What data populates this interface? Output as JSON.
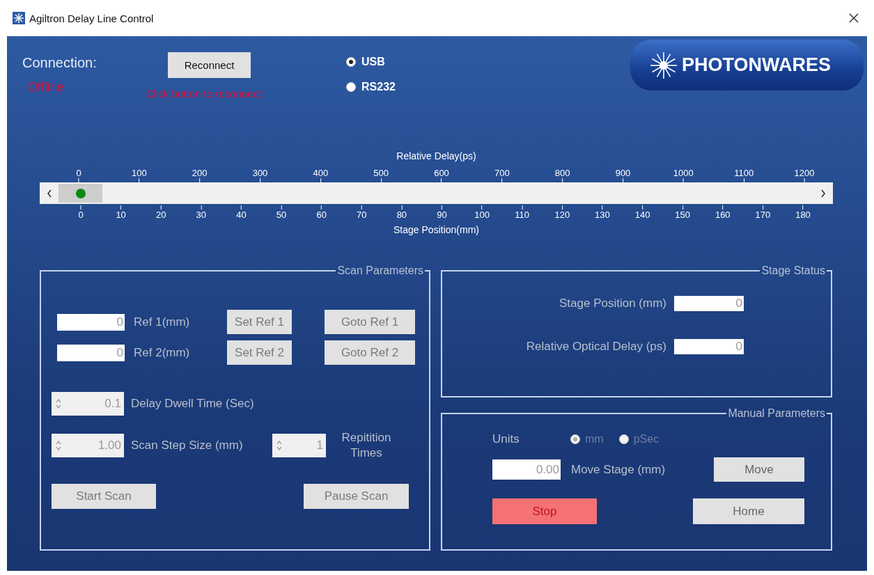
{
  "window": {
    "title": "Agiltron Delay Line Control"
  },
  "connection": {
    "label": "Connection:",
    "button": "Reconnect",
    "status": "Offline",
    "hint": "Click button to reconnect",
    "ports": [
      {
        "label": "USB",
        "selected": true
      },
      {
        "label": "RS232",
        "selected": false
      }
    ]
  },
  "logo": {
    "text": "PHOTONWARES"
  },
  "scale": {
    "top_title": "Relative Delay(ps)",
    "top_ticks": [
      "0",
      "100",
      "200",
      "300",
      "400",
      "500",
      "600",
      "700",
      "800",
      "900",
      "1000",
      "1100",
      "1200"
    ],
    "bottom_ticks": [
      "0",
      "10",
      "20",
      "30",
      "40",
      "50",
      "60",
      "70",
      "80",
      "90",
      "100",
      "110",
      "120",
      "130",
      "140",
      "150",
      "160",
      "170",
      "180"
    ],
    "bottom_title": "Stage Position(mm)"
  },
  "scan_parameters": {
    "title": "Scan Parameters",
    "refs": [
      {
        "value": "0",
        "label": "Ref 1(mm)",
        "set_button": "Set Ref 1",
        "goto_button": "Goto Ref 1"
      },
      {
        "value": "0",
        "label": "Ref 2(mm)",
        "set_button": "Set Ref 2",
        "goto_button": "Goto Ref 2"
      }
    ],
    "dwell": {
      "value": "0.1",
      "label": "Delay Dwell Time (Sec)"
    },
    "step": {
      "value": "1.00",
      "label": "Scan Step Size (mm)"
    },
    "repetition": {
      "value": "1",
      "label": "Repitition Times"
    },
    "start_button": "Start Scan",
    "pause_button": "Pause Scan"
  },
  "stage_status": {
    "title": "Stage Status",
    "fields": [
      {
        "label": "Stage Position (mm)",
        "value": "0"
      },
      {
        "label": "Relative Optical Delay (ps)",
        "value": "0"
      }
    ]
  },
  "manual_parameters": {
    "title": "Manual Parameters",
    "units_label": "Units",
    "units_disabled": true,
    "units": [
      {
        "label": "mm",
        "selected": true
      },
      {
        "label": "pSec",
        "selected": false
      }
    ],
    "move": {
      "value": "0.00",
      "label": "Move Stage (mm)",
      "button": "Move"
    },
    "stop_button": "Stop",
    "home_button": "Home"
  }
}
